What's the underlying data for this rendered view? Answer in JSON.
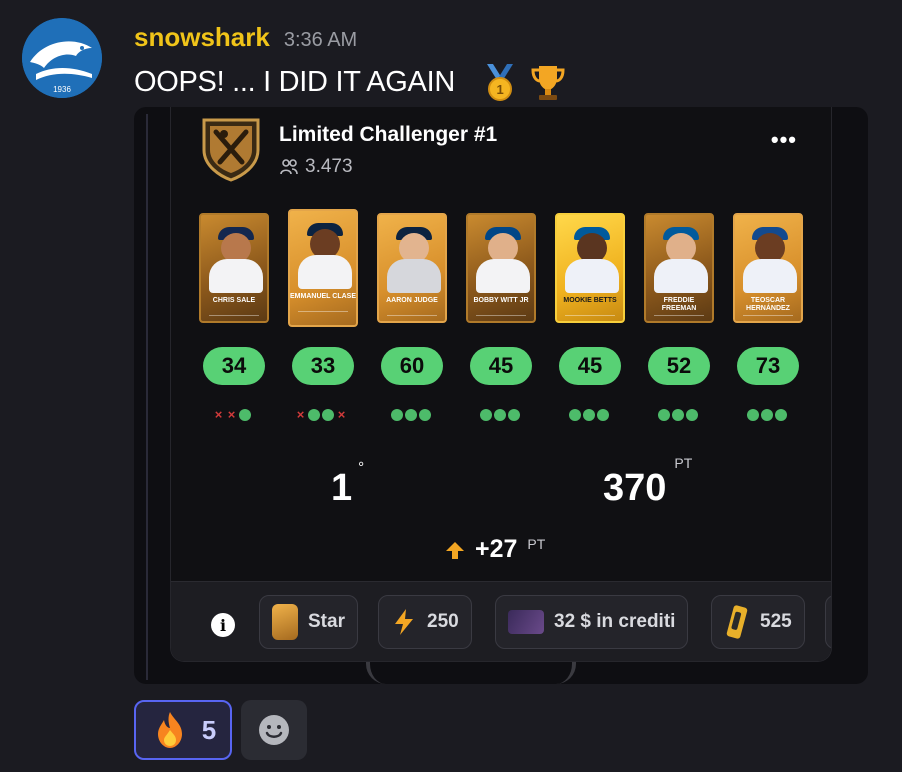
{
  "message": {
    "username": "snowshark",
    "timestamp": "3:36 AM",
    "text": "OOPS! ... I DID IT AGAIN",
    "avatar_label": "1936",
    "emojis": [
      "first-place-medal-icon",
      "trophy-icon"
    ]
  },
  "contest": {
    "title": "Limited Challenger #1",
    "participants": "3.473",
    "menu_label": "•••",
    "players": [
      {
        "name": "CHRIS SALE",
        "score": "34",
        "dots": [
          "x",
          "x",
          "o"
        ]
      },
      {
        "name": "EMMANUEL CLASE",
        "score": "33",
        "dots": [
          "x",
          "o",
          "o",
          "x"
        ]
      },
      {
        "name": "AARON JUDGE",
        "score": "60",
        "dots": [
          "o",
          "o",
          "o"
        ]
      },
      {
        "name": "BOBBY WITT JR",
        "score": "45",
        "dots": [
          "o",
          "o",
          "o"
        ]
      },
      {
        "name": "MOOKIE BETTS",
        "score": "45",
        "dots": [
          "o",
          "o",
          "o"
        ]
      },
      {
        "name": "FREDDIE FREEMAN",
        "score": "52",
        "dots": [
          "o",
          "o",
          "o"
        ]
      },
      {
        "name": "TEOSCAR HERNÁNDEZ",
        "score": "73",
        "dots": [
          "o",
          "o",
          "o"
        ]
      }
    ],
    "rank": "1",
    "rank_suffix": "°",
    "points": "370",
    "points_unit": "PT",
    "delta": "+27",
    "delta_unit": "PT"
  },
  "rewards": [
    {
      "label": "Star",
      "icon": "star-card-icon"
    },
    {
      "label": "250",
      "icon": "lightning-icon"
    },
    {
      "label": "32 $ in crediti",
      "icon": "credits-card-icon"
    },
    {
      "label": "525",
      "icon": "gold-pack-icon"
    }
  ],
  "reactions": {
    "fire_count": "5"
  },
  "colors": {
    "username": "#f0c419",
    "score_pill": "#58d175",
    "reaction_border": "#5865f2",
    "miss": "#d23b3b"
  }
}
